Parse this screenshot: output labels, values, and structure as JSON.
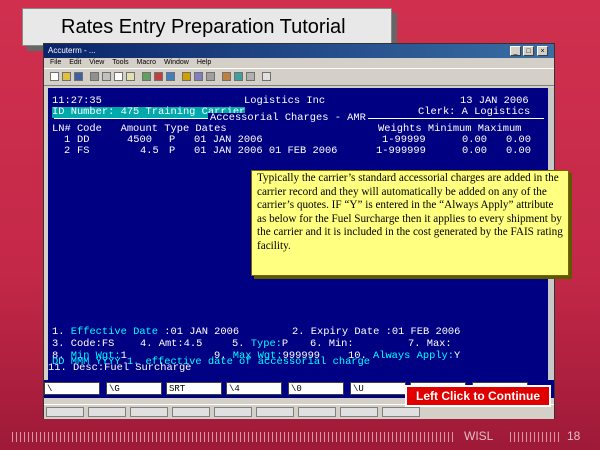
{
  "slide": {
    "title": "Rates Entry Preparation Tutorial",
    "footer_brand": "WISL",
    "page_number": "18",
    "continue_label": "Left Click to Continue"
  },
  "window": {
    "title": "Accuterm - ...",
    "menu": [
      "File",
      "Edit",
      "View",
      "Tools",
      "Macro",
      "Window",
      "Help"
    ]
  },
  "terminal": {
    "time": "11:27:35",
    "company": "Logistics Inc",
    "date": "13 JAN 2006",
    "id_line": "ID Number: 475 Training Carrier",
    "clerk": "Clerk: A Logistics",
    "section": "Accessorial Charges - AMR",
    "col_header_left": "LN# Code   Amount Type Dates",
    "col_header_right": "Weights Minimum Maximum",
    "rows": [
      {
        "ln": "1",
        "code": "DD",
        "amount": "4500",
        "type": "P",
        "dates": "01 JAN 2006",
        "weights": "1-99999",
        "minimum": "0.00",
        "maximum": "0.00"
      },
      {
        "ln": "2",
        "code": "FS",
        "amount": "4.5",
        "type": "P",
        "dates": "01 JAN 2006 01 FEB 2006",
        "weights": "1-999999",
        "minimum": "0.00",
        "maximum": "0.00"
      }
    ],
    "f1_num": "1.",
    "f1_label": "Effective Date",
    "f1_value": ":01 JAN 2006",
    "f2_num": "2.",
    "f2_label": "Expiry Date",
    "f2_value": ":01 FEB 2006",
    "f3": "3. Code:FS",
    "f4": "4. Amt:4.5",
    "f5_num": "5.",
    "f5_label": "Type:",
    "f5_value": "P",
    "f6": "6. Min:",
    "f7": "7. Max:",
    "f8_num": "8.",
    "f8_label": "Min Wgt:",
    "f8_value": "1",
    "f9_num": "9.",
    "f9_label": "Max Wgt:",
    "f9_value": "999999",
    "f10_num": "10.",
    "f10_label": "Always Apply:",
    "f10_value": "Y",
    "f11": "11. Desc:Fuel Surcharge",
    "prompt": "DD MMM YYYY 1. effective date of accessorial charge"
  },
  "input_fields": [
    "\\",
    "\\G",
    "SRT",
    "\\4",
    "\\0",
    "\\U",
    "",
    ""
  ],
  "callout": {
    "text": "Typically the carrier’s standard accessorial charges are added in the carrier record and they will automatically be added on any of the carrier’s quotes. IF “Y” is entered in the “Always Apply” attribute as below for the Fuel Surcharge then it applies to every shipment by the carrier and it is included in the cost generated by the FAIS rating facility."
  },
  "colors": {
    "background": "#c42848",
    "terminal": "#000082",
    "callout": "#ffff80",
    "button": "#e00000"
  }
}
